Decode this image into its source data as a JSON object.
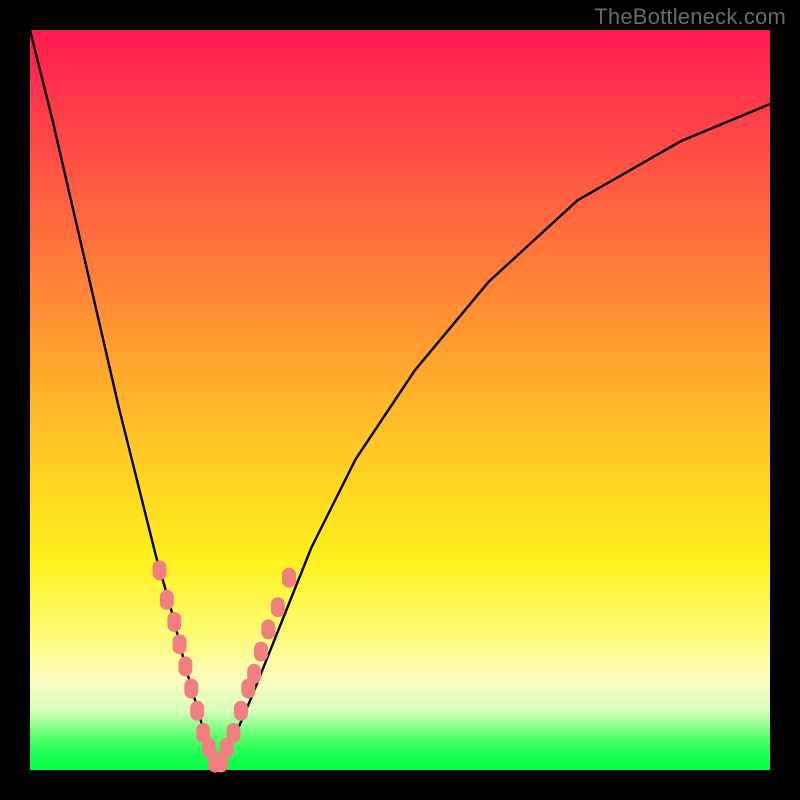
{
  "watermark": "TheBottleneck.com",
  "chart_data": {
    "type": "line",
    "title": "",
    "xlabel": "",
    "ylabel": "",
    "xlim": [
      0,
      100
    ],
    "ylim": [
      0,
      100
    ],
    "series": [
      {
        "name": "bottleneck-curve",
        "x": [
          0,
          3,
          6,
          9,
          12,
          15,
          17,
          19,
          21,
          23,
          24,
          25,
          26,
          27,
          30,
          34,
          38,
          44,
          52,
          62,
          74,
          88,
          100
        ],
        "y": [
          100,
          88,
          75,
          62,
          49,
          37,
          29,
          22,
          14,
          7,
          3,
          1,
          1,
          3,
          10,
          20,
          30,
          42,
          54,
          66,
          77,
          85,
          90
        ]
      }
    ],
    "markers": {
      "name": "highlighted-points",
      "points": [
        {
          "x": 17.5,
          "y": 27
        },
        {
          "x": 18.5,
          "y": 23
        },
        {
          "x": 19.5,
          "y": 20
        },
        {
          "x": 20.2,
          "y": 17
        },
        {
          "x": 21.0,
          "y": 14
        },
        {
          "x": 21.8,
          "y": 11
        },
        {
          "x": 22.6,
          "y": 8
        },
        {
          "x": 23.4,
          "y": 5
        },
        {
          "x": 24.2,
          "y": 3
        },
        {
          "x": 25.0,
          "y": 1
        },
        {
          "x": 25.8,
          "y": 1
        },
        {
          "x": 26.6,
          "y": 3
        },
        {
          "x": 27.5,
          "y": 5
        },
        {
          "x": 28.5,
          "y": 8
        },
        {
          "x": 29.5,
          "y": 11
        },
        {
          "x": 30.3,
          "y": 13
        },
        {
          "x": 31.2,
          "y": 16
        },
        {
          "x": 32.2,
          "y": 19
        },
        {
          "x": 33.5,
          "y": 22
        },
        {
          "x": 35.0,
          "y": 26
        }
      ]
    },
    "colors": {
      "curve": "#000000",
      "markers": "#f27f7f",
      "gradient_top": "#ff1a52",
      "gradient_bottom": "#0aff40"
    }
  }
}
